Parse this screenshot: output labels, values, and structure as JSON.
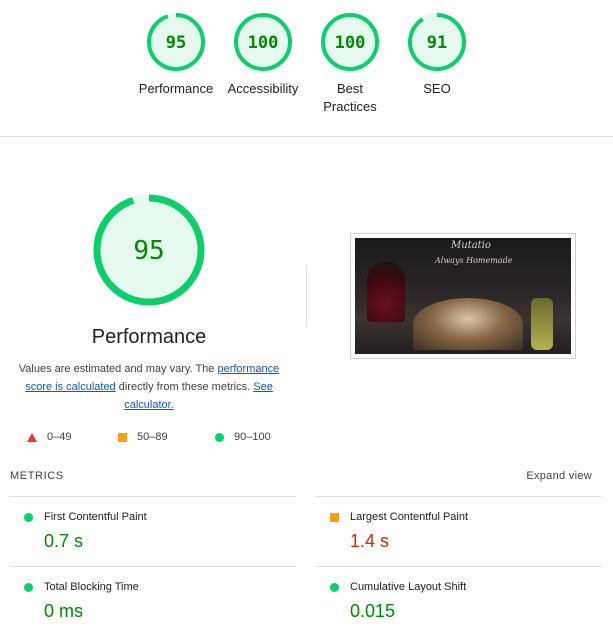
{
  "summary": [
    {
      "score": "95",
      "label": "Performance",
      "level": 0.95
    },
    {
      "score": "100",
      "label": "Accessibility",
      "level": 1.0
    },
    {
      "score": "100",
      "label": "Best\nPractices",
      "level": 1.0
    },
    {
      "score": "91",
      "label": "SEO",
      "level": 0.91
    }
  ],
  "performance": {
    "score": "95",
    "level": 0.95,
    "title": "Performance",
    "note_prefix": "Values are estimated and may vary. The ",
    "note_link1": "performance score is calculated",
    "note_mid": " directly from these metrics. ",
    "note_link2": "See calculator."
  },
  "legend": [
    {
      "range": "0–49",
      "shape": "triangle",
      "color": "#e53935"
    },
    {
      "range": "50–89",
      "shape": "square",
      "color": "#fa9c1c"
    },
    {
      "range": "90–100",
      "shape": "circle",
      "color": "#0cce6b"
    }
  ],
  "screenshot": {
    "brand": "Mutatio",
    "tagline": "Always Homemade"
  },
  "metrics_header": "METRICS",
  "expand_label": "Expand view",
  "metrics": [
    {
      "name": "First Contentful Paint",
      "value": "0.7 s",
      "status": "pass"
    },
    {
      "name": "Largest Contentful Paint",
      "value": "1.4 s",
      "status": "average"
    },
    {
      "name": "Total Blocking Time",
      "value": "0 ms",
      "status": "pass"
    },
    {
      "name": "Cumulative Layout Shift",
      "value": "0.015",
      "status": "pass"
    }
  ],
  "colors": {
    "pass": "#0cce6b",
    "pass_text": "#008800",
    "average": "#fa9c1c",
    "average_text": "#c33300",
    "gauge_bg": "#e5f9ee"
  }
}
